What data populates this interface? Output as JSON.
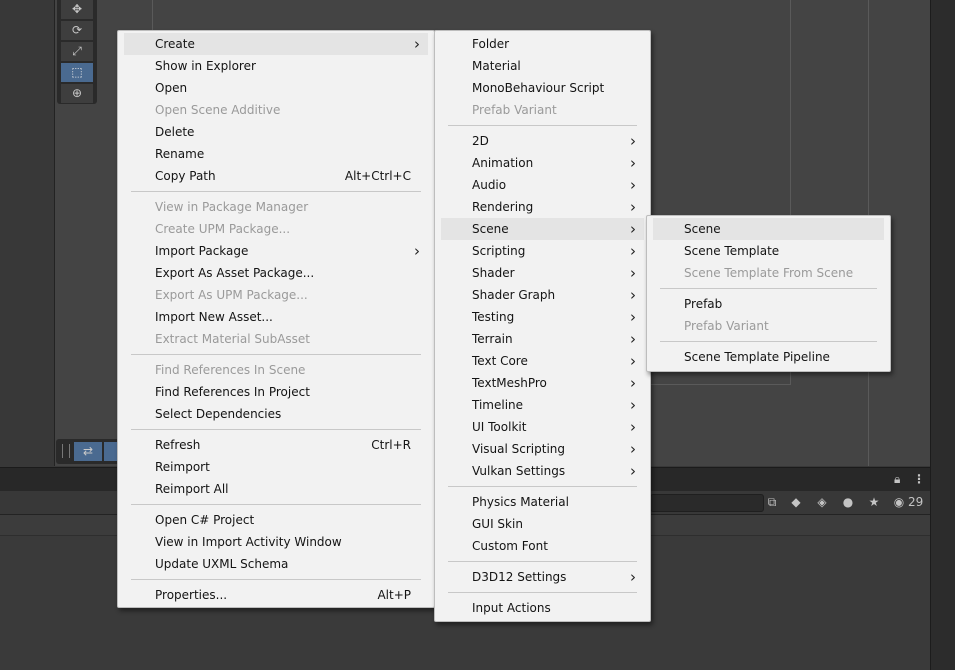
{
  "editor": {
    "tool_icons": [
      "move-icon",
      "rotate-icon",
      "scale-icon",
      "rect-transform-icon",
      "transform-icon"
    ],
    "lock_icon": "lock-icon",
    "kebab_icon": "kebab-menu-icon",
    "visible_count": "29"
  },
  "main_menu": {
    "items": [
      {
        "label": "Create",
        "submenu": true,
        "highlighted": true
      },
      {
        "label": "Show in Explorer"
      },
      {
        "label": "Open"
      },
      {
        "label": "Open Scene Additive",
        "disabled": true
      },
      {
        "label": "Delete"
      },
      {
        "label": "Rename"
      },
      {
        "label": "Copy Path",
        "shortcut": "Alt+Ctrl+C"
      },
      {
        "separator": true
      },
      {
        "label": "View in Package Manager",
        "disabled": true
      },
      {
        "label": "Create UPM Package...",
        "disabled": true
      },
      {
        "label": "Import Package",
        "submenu": true
      },
      {
        "label": "Export As Asset Package..."
      },
      {
        "label": "Export As UPM Package...",
        "disabled": true
      },
      {
        "label": "Import New Asset..."
      },
      {
        "label": "Extract Material SubAsset",
        "disabled": true
      },
      {
        "separator": true
      },
      {
        "label": "Find References In Scene",
        "disabled": true
      },
      {
        "label": "Find References In Project"
      },
      {
        "label": "Select Dependencies"
      },
      {
        "separator": true
      },
      {
        "label": "Refresh",
        "shortcut": "Ctrl+R"
      },
      {
        "label": "Reimport"
      },
      {
        "label": "Reimport All"
      },
      {
        "separator": true
      },
      {
        "label": "Open C# Project"
      },
      {
        "label": "View in Import Activity Window"
      },
      {
        "label": "Update UXML Schema"
      },
      {
        "separator": true
      },
      {
        "label": "Properties...",
        "shortcut": "Alt+P"
      }
    ]
  },
  "create_menu": {
    "items": [
      {
        "label": "Folder"
      },
      {
        "label": "Material"
      },
      {
        "label": "MonoBehaviour Script"
      },
      {
        "label": "Prefab Variant",
        "disabled": true
      },
      {
        "separator": true
      },
      {
        "label": "2D",
        "submenu": true
      },
      {
        "label": "Animation",
        "submenu": true
      },
      {
        "label": "Audio",
        "submenu": true
      },
      {
        "label": "Rendering",
        "submenu": true
      },
      {
        "label": "Scene",
        "submenu": true,
        "highlighted": true
      },
      {
        "label": "Scripting",
        "submenu": true
      },
      {
        "label": "Shader",
        "submenu": true
      },
      {
        "label": "Shader Graph",
        "submenu": true
      },
      {
        "label": "Testing",
        "submenu": true
      },
      {
        "label": "Terrain",
        "submenu": true
      },
      {
        "label": "Text Core",
        "submenu": true
      },
      {
        "label": "TextMeshPro",
        "submenu": true
      },
      {
        "label": "Timeline",
        "submenu": true
      },
      {
        "label": "UI Toolkit",
        "submenu": true
      },
      {
        "label": "Visual Scripting",
        "submenu": true
      },
      {
        "label": "Vulkan Settings",
        "submenu": true
      },
      {
        "separator": true
      },
      {
        "label": "Physics Material"
      },
      {
        "label": "GUI Skin"
      },
      {
        "label": "Custom Font"
      },
      {
        "separator": true
      },
      {
        "label": "D3D12 Settings",
        "submenu": true
      },
      {
        "separator": true
      },
      {
        "label": "Input Actions"
      }
    ]
  },
  "scene_menu": {
    "items": [
      {
        "label": "Scene",
        "highlighted": true
      },
      {
        "label": "Scene Template"
      },
      {
        "label": "Scene Template From Scene",
        "disabled": true
      },
      {
        "separator": true
      },
      {
        "label": "Prefab"
      },
      {
        "label": "Prefab Variant",
        "disabled": true
      },
      {
        "separator": true
      },
      {
        "label": "Scene Template Pipeline"
      }
    ]
  },
  "colors": {
    "menu_bg": "#f2f2f2",
    "highlight": "#e4e4e4",
    "disabled_text": "#9a9a9a",
    "active_tool": "#4a6a90"
  }
}
